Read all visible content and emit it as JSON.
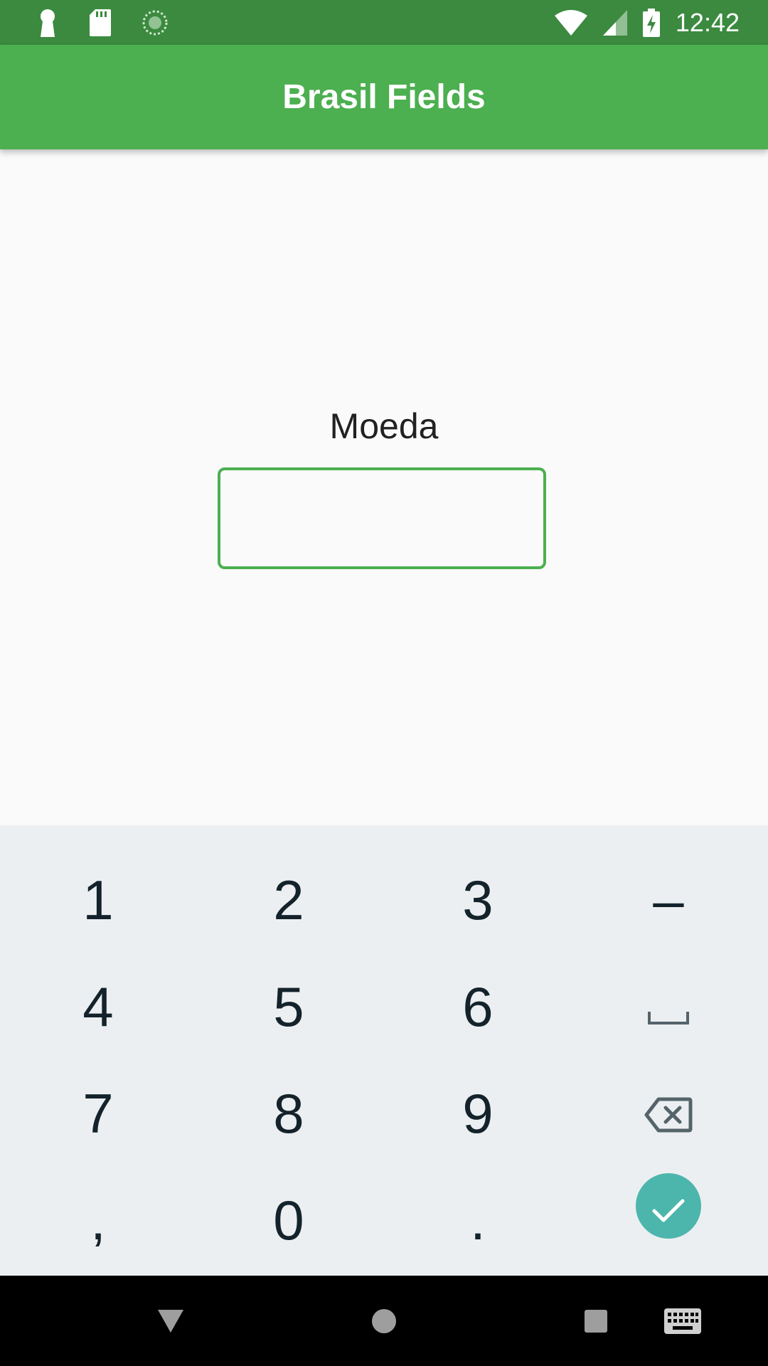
{
  "status_bar": {
    "time": "12:42",
    "icons": [
      "keyhole-icon",
      "sd-card-icon",
      "sync-icon",
      "wifi-icon",
      "signal-icon",
      "battery-charging-icon"
    ]
  },
  "app_bar": {
    "title": "Brasil Fields"
  },
  "form": {
    "label": "Moeda",
    "value": "",
    "accent_color": "#4caf50"
  },
  "keyboard": {
    "rows": [
      [
        "1",
        "2",
        "3",
        "–"
      ],
      [
        "4",
        "5",
        "6",
        "space-icon"
      ],
      [
        "7",
        "8",
        "9",
        "backspace-icon"
      ],
      [
        ",",
        "0",
        ".",
        "enter-check-icon"
      ]
    ],
    "keys": {
      "k1": "1",
      "k2": "2",
      "k3": "3",
      "dash": "–",
      "k4": "4",
      "k5": "5",
      "k6": "6",
      "k7": "7",
      "k8": "8",
      "k9": "9",
      "comma": ",",
      "k0": "0",
      "period": "."
    },
    "enter_color": "#4db6ac"
  },
  "nav_bar": {
    "buttons": [
      "back-icon",
      "home-icon",
      "recents-icon",
      "keyboard-switch-icon"
    ]
  },
  "colors": {
    "status_bar": "#3b8a3f",
    "app_bar": "#4caf50",
    "keyboard_bg": "#eceff1"
  }
}
